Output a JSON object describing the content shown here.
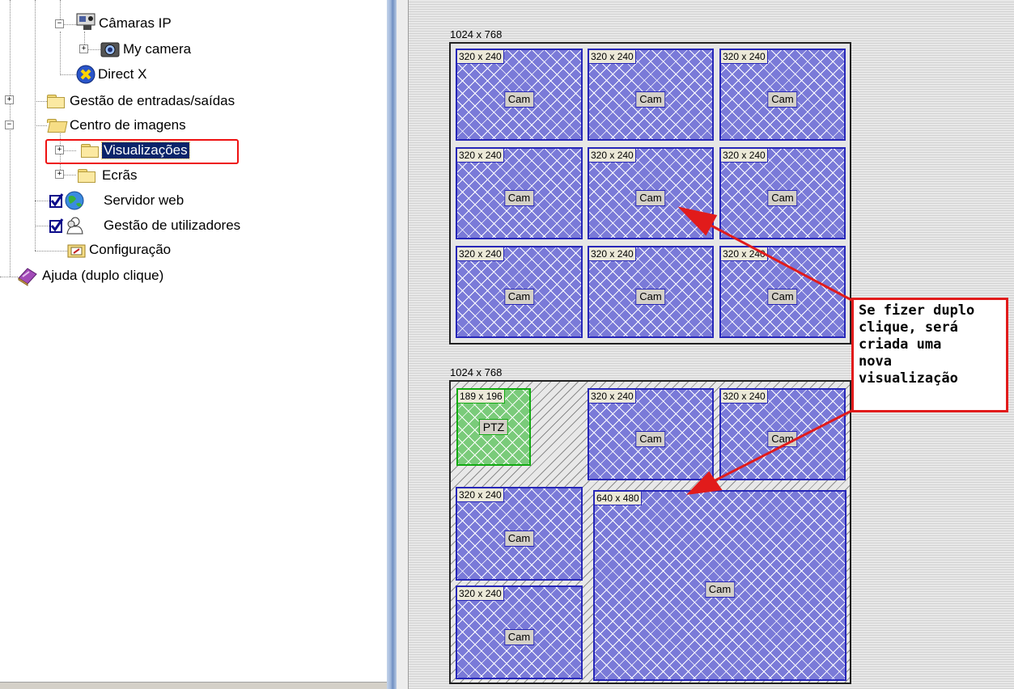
{
  "tree": {
    "nodes": [
      {
        "label": "Câmaras IP",
        "icon": "ip-camera-icon"
      },
      {
        "label": "My camera",
        "icon": "camera-icon"
      },
      {
        "label": "Direct X",
        "icon": "directx-icon"
      },
      {
        "label": "Gestão de entradas/saídas",
        "icon": "folder-icon"
      },
      {
        "label": "Centro de imagens",
        "icon": "folder-open-icon"
      },
      {
        "label": "Visualizações",
        "icon": "folder-icon",
        "selected": true
      },
      {
        "label": "Ecrãs",
        "icon": "folder-icon"
      },
      {
        "label": "Servidor web",
        "icon": "globe-icon",
        "checked": true
      },
      {
        "label": "Gestão de utilizadores",
        "icon": "users-icon",
        "checked": true
      },
      {
        "label": "Configuração",
        "icon": "config-icon"
      },
      {
        "label": "Ajuda (duplo clique)",
        "icon": "help-book-icon"
      }
    ],
    "highlight_color": "#ee1111",
    "selection_color": "#0a246a"
  },
  "layouts": [
    {
      "resolution": "1024 x 768",
      "cells": [
        {
          "size": "320 x 240",
          "button": "Cam"
        },
        {
          "size": "320 x 240",
          "button": "Cam"
        },
        {
          "size": "320 x 240",
          "button": "Cam"
        },
        {
          "size": "320 x 240",
          "button": "Cam"
        },
        {
          "size": "320 x 240",
          "button": "Cam"
        },
        {
          "size": "320 x 240",
          "button": "Cam"
        },
        {
          "size": "320 x 240",
          "button": "Cam"
        },
        {
          "size": "320 x 240",
          "button": "Cam"
        },
        {
          "size": "320 x 240",
          "button": "Cam"
        }
      ]
    },
    {
      "resolution": "1024 x 768",
      "cells": [
        {
          "size": "189 x 196",
          "button": "PTZ",
          "kind": "ptz"
        },
        {
          "size": "320 x 240",
          "button": "Cam"
        },
        {
          "size": "320 x 240",
          "button": "Cam"
        },
        {
          "size": "320 x 240",
          "button": "Cam"
        },
        {
          "size": "640 x 480",
          "button": "Cam"
        },
        {
          "size": "320 x 240",
          "button": "Cam"
        }
      ]
    }
  ],
  "callout": {
    "lines": [
      "Se fizer duplo",
      "clique, será",
      "criada uma",
      "nova",
      "visualização"
    ],
    "color": "#e11b1b"
  },
  "colors": {
    "cam_border": "#2727b8",
    "ptz_border": "#11aa11"
  }
}
